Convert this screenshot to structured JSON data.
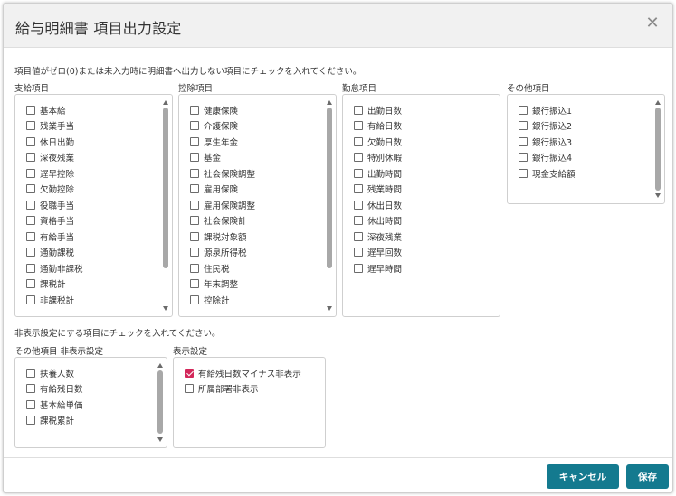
{
  "dialog": {
    "title": "給与明細書 項目出力設定",
    "close_glyph": "✕"
  },
  "instruction_top": "項目値がゼロ(0)または未入力時に明細書へ出力しない項目にチェックを入れてください。",
  "instruction_bottom": "非表示設定にする項目にチェックを入れてください。",
  "groups": {
    "payment": {
      "label": "支給項目",
      "items": [
        "基本給",
        "残業手当",
        "休日出勤",
        "深夜残業",
        "遅早控除",
        "欠勤控除",
        "役職手当",
        "資格手当",
        "有給手当",
        "通勤課税",
        "通勤非課税",
        "課税計",
        "非課税計"
      ]
    },
    "deduction": {
      "label": "控除項目",
      "items": [
        "健康保険",
        "介護保険",
        "厚生年金",
        "基金",
        "社会保険調整",
        "雇用保険",
        "雇用保険調整",
        "社会保険計",
        "課税対象額",
        "源泉所得税",
        "住民税",
        "年末調整",
        "控除計"
      ]
    },
    "attendance": {
      "label": "勤怠項目",
      "items": [
        "出勤日数",
        "有給日数",
        "欠勤日数",
        "特別休暇",
        "出勤時間",
        "残業時間",
        "休出日数",
        "休出時間",
        "深夜残業",
        "遅早回数",
        "遅早時間"
      ]
    },
    "other": {
      "label": "その他項目",
      "items": [
        "銀行振込1",
        "銀行振込2",
        "銀行振込3",
        "銀行振込4",
        "現金支給額"
      ]
    },
    "other_hidden": {
      "label": "その他項目 非表示設定",
      "items": [
        "扶養人数",
        "有給残日数",
        "基本給単価",
        "課税累計"
      ]
    },
    "display": {
      "label": "表示設定",
      "items": [
        {
          "label": "有給残日数マイナス非表示",
          "checked": true
        },
        {
          "label": "所属部署非表示",
          "checked": false
        }
      ]
    }
  },
  "buttons": {
    "cancel": "キャンセル",
    "save": "保存"
  },
  "colors": {
    "primary": "#147a8f",
    "checkbox_checked": "#d3275a"
  }
}
